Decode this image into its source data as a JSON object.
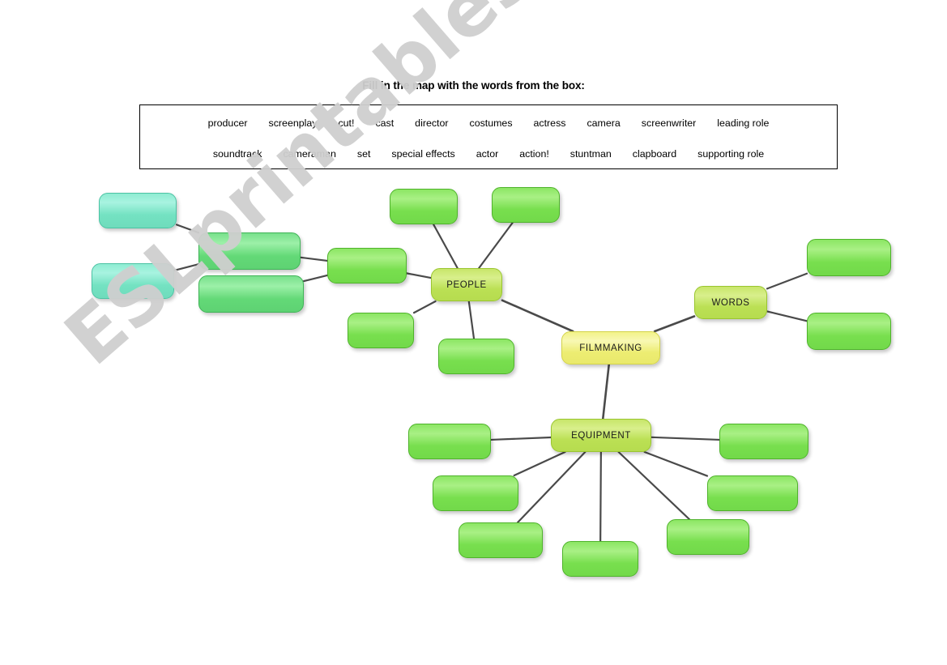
{
  "worksheet": {
    "title": "Fill in the map with the words from the box:",
    "watermark": "ESLprintables.com"
  },
  "word_bank": {
    "row1": [
      "producer",
      "screenplay",
      "cut!",
      "cast",
      "director",
      "costumes",
      "actress",
      "camera",
      "screenwriter",
      "leading role"
    ],
    "row2": [
      "soundtrack",
      "cameraman",
      "set",
      "special effects",
      "actor",
      "action!",
      "stuntman",
      "clapboard",
      "supporting role"
    ]
  },
  "mind_map": {
    "center": {
      "label": "FILMMAKING"
    },
    "categories": [
      {
        "label": "PEOPLE"
      },
      {
        "label": "WORDS"
      },
      {
        "label": "EQUIPMENT"
      }
    ],
    "blanks": [
      {
        "label": ""
      },
      {
        "label": ""
      },
      {
        "label": ""
      },
      {
        "label": ""
      },
      {
        "label": ""
      },
      {
        "label": ""
      },
      {
        "label": ""
      },
      {
        "label": ""
      },
      {
        "label": ""
      },
      {
        "label": ""
      },
      {
        "label": ""
      },
      {
        "label": ""
      },
      {
        "label": ""
      },
      {
        "label": ""
      },
      {
        "label": ""
      },
      {
        "label": ""
      },
      {
        "label": ""
      },
      {
        "label": ""
      }
    ]
  },
  "colors": {
    "teal": "#7fe8c8",
    "medium_green": "#6fdd7f",
    "light_green": "#84e05a",
    "category": "#c2e25e",
    "center_yellow": "#f0f08a",
    "edge": "#4a4a4a",
    "watermark": "#cfcfcf"
  }
}
